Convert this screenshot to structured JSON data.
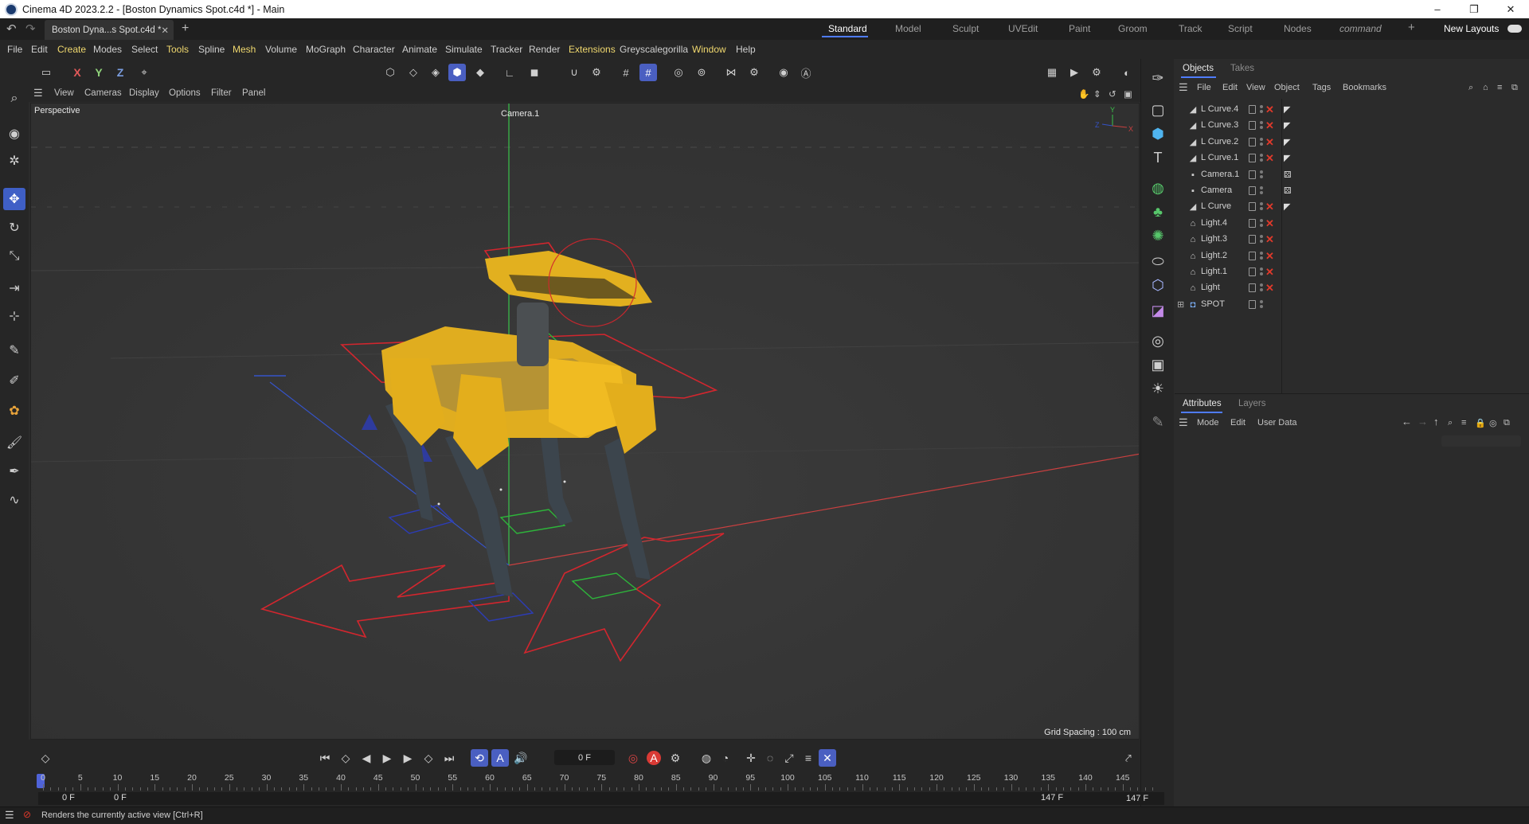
{
  "window": {
    "title": "Cinema 4D 2023.2.2 - [Boston Dynamics Spot.c4d *] - Main",
    "minimize": "–",
    "maximize": "❐",
    "close": "✕"
  },
  "doc_tab": {
    "label": "Boston Dyna...s Spot.c4d *",
    "close": "✕",
    "add": "+"
  },
  "layouts": {
    "items": [
      "Standard",
      "Model",
      "Sculpt",
      "UVEdit",
      "Paint",
      "Groom",
      "Track",
      "Script",
      "Nodes",
      "command"
    ],
    "active": "Standard",
    "add": "+",
    "new_layouts": "New Layouts"
  },
  "menu": [
    "File",
    "Edit",
    "Create",
    "Modes",
    "Select",
    "Tools",
    "Spline",
    "Mesh",
    "Volume",
    "MoGraph",
    "Character",
    "Animate",
    "Simulate",
    "Tracker",
    "Render",
    "Extensions",
    "Greyscalegorilla",
    "Window",
    "Help"
  ],
  "toolbar": {
    "axis_x": "X",
    "axis_y": "Y",
    "axis_z": "Z"
  },
  "viewport": {
    "menu": [
      "View",
      "Cameras",
      "Display",
      "Options",
      "Filter",
      "Panel"
    ],
    "label": "Perspective",
    "camera_label": "Camera.1",
    "grid_spacing": "Grid Spacing : 100 cm"
  },
  "objects_panel": {
    "tabs": [
      "Objects",
      "Takes"
    ],
    "menu": [
      "File",
      "Edit",
      "View",
      "Object",
      "Tags",
      "Bookmarks"
    ],
    "rows": [
      {
        "name": "L Curve.4",
        "icon": "curve-icon",
        "x": true,
        "tag": true
      },
      {
        "name": "L Curve.3",
        "icon": "curve-icon",
        "x": true,
        "tag": true
      },
      {
        "name": "L Curve.2",
        "icon": "curve-icon",
        "x": true,
        "tag": true
      },
      {
        "name": "L Curve.1",
        "icon": "curve-icon",
        "x": true,
        "tag": true
      },
      {
        "name": "Camera.1",
        "icon": "camera-icon",
        "x": false,
        "tag": true
      },
      {
        "name": "Camera",
        "icon": "camera-icon",
        "x": false,
        "tag": true
      },
      {
        "name": "L Curve",
        "icon": "curve-icon",
        "x": true,
        "tag": true
      },
      {
        "name": "Light.4",
        "icon": "light-icon",
        "x": true,
        "tag": false
      },
      {
        "name": "Light.3",
        "icon": "light-icon",
        "x": true,
        "tag": false
      },
      {
        "name": "Light.2",
        "icon": "light-icon",
        "x": true,
        "tag": false
      },
      {
        "name": "Light.1",
        "icon": "light-icon",
        "x": true,
        "tag": false
      },
      {
        "name": "Light",
        "icon": "light-icon",
        "x": true,
        "tag": false
      },
      {
        "name": "SPOT",
        "icon": "null-icon",
        "x": false,
        "tag": false
      }
    ]
  },
  "attributes_panel": {
    "tabs": [
      "Attributes",
      "Layers"
    ],
    "menu": [
      "Mode",
      "Edit",
      "User Data"
    ]
  },
  "timeline": {
    "current_frame": "0 F",
    "ticks": [
      "0",
      "5",
      "10",
      "15",
      "20",
      "25",
      "30",
      "35",
      "40",
      "45",
      "50",
      "55",
      "60",
      "65",
      "70",
      "75",
      "80",
      "85",
      "90",
      "95",
      "100",
      "105",
      "110",
      "115",
      "120",
      "125",
      "130",
      "135",
      "140",
      "145"
    ],
    "range_start": "0 F",
    "range_start2": "0 F",
    "range_end": "147 F",
    "range_end2": "147 F",
    "autokey_label": "A"
  },
  "status": {
    "text": "Renders the currently active view [Ctrl+R]"
  },
  "colors": {
    "accent": "#4f7cff",
    "active_tool": "#3f5fc6",
    "delete_x": "#e0392b",
    "menu_highlight": "#f0d86e"
  }
}
